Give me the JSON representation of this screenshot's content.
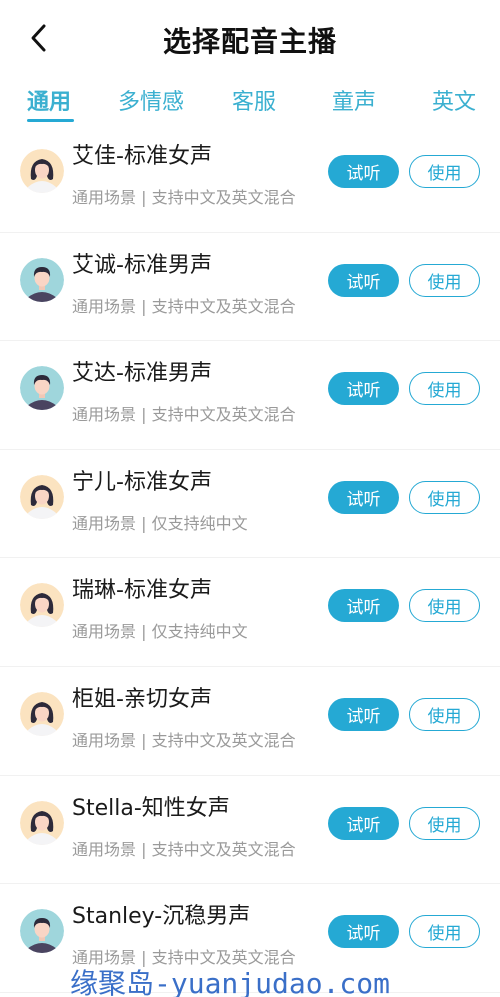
{
  "header": {
    "title": "选择配音主播",
    "back_icon": "chevron-left-icon"
  },
  "tabs": [
    {
      "label": "通用",
      "active": true
    },
    {
      "label": "多情感",
      "active": false
    },
    {
      "label": "客服",
      "active": false
    },
    {
      "label": "童声",
      "active": false
    },
    {
      "label": "英文",
      "active": false
    }
  ],
  "colors": {
    "accent": "#25a9d4",
    "tab_text": "#3bb0d0",
    "muted": "#9a9a9a",
    "female_bg": "#fbe3c0",
    "male_bg": "#9fd6dc"
  },
  "voices": [
    {
      "name": "艾佳-标准女声",
      "desc": "通用场景 | 支持中文及英文混合",
      "gender": "female",
      "try": "试听",
      "use": "使用"
    },
    {
      "name": "艾诚-标准男声",
      "desc": "通用场景 | 支持中文及英文混合",
      "gender": "male",
      "try": "试听",
      "use": "使用"
    },
    {
      "name": "艾达-标准男声",
      "desc": "通用场景 | 支持中文及英文混合",
      "gender": "male",
      "try": "试听",
      "use": "使用"
    },
    {
      "name": "宁儿-标准女声",
      "desc": "通用场景 | 仅支持纯中文",
      "gender": "female",
      "try": "试听",
      "use": "使用"
    },
    {
      "name": "瑞琳-标准女声",
      "desc": "通用场景 | 仅支持纯中文",
      "gender": "female",
      "try": "试听",
      "use": "使用"
    },
    {
      "name": "柜姐-亲切女声",
      "desc": "通用场景 | 支持中文及英文混合",
      "gender": "female",
      "try": "试听",
      "use": "使用"
    },
    {
      "name": "Stella-知性女声",
      "desc": "通用场景 | 支持中文及英文混合",
      "gender": "female",
      "try": "试听",
      "use": "使用"
    },
    {
      "name": "Stanley-沉稳男声",
      "desc": "通用场景 | 支持中文及英文混合",
      "gender": "male",
      "try": "试听",
      "use": "使用"
    }
  ],
  "watermark": "缘聚岛-yuanjudao.com"
}
